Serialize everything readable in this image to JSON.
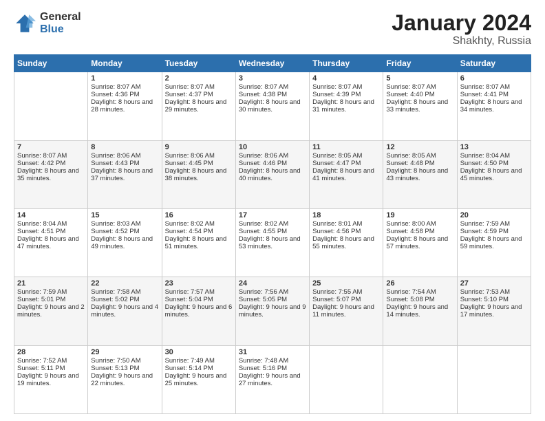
{
  "logo": {
    "general": "General",
    "blue": "Blue"
  },
  "title": {
    "month_year": "January 2024",
    "location": "Shakhty, Russia"
  },
  "header_days": [
    "Sunday",
    "Monday",
    "Tuesday",
    "Wednesday",
    "Thursday",
    "Friday",
    "Saturday"
  ],
  "weeks": [
    [
      {
        "day": "",
        "sunrise": "",
        "sunset": "",
        "daylight": ""
      },
      {
        "day": "1",
        "sunrise": "Sunrise: 8:07 AM",
        "sunset": "Sunset: 4:36 PM",
        "daylight": "Daylight: 8 hours and 28 minutes."
      },
      {
        "day": "2",
        "sunrise": "Sunrise: 8:07 AM",
        "sunset": "Sunset: 4:37 PM",
        "daylight": "Daylight: 8 hours and 29 minutes."
      },
      {
        "day": "3",
        "sunrise": "Sunrise: 8:07 AM",
        "sunset": "Sunset: 4:38 PM",
        "daylight": "Daylight: 8 hours and 30 minutes."
      },
      {
        "day": "4",
        "sunrise": "Sunrise: 8:07 AM",
        "sunset": "Sunset: 4:39 PM",
        "daylight": "Daylight: 8 hours and 31 minutes."
      },
      {
        "day": "5",
        "sunrise": "Sunrise: 8:07 AM",
        "sunset": "Sunset: 4:40 PM",
        "daylight": "Daylight: 8 hours and 33 minutes."
      },
      {
        "day": "6",
        "sunrise": "Sunrise: 8:07 AM",
        "sunset": "Sunset: 4:41 PM",
        "daylight": "Daylight: 8 hours and 34 minutes."
      }
    ],
    [
      {
        "day": "7",
        "sunrise": "Sunrise: 8:07 AM",
        "sunset": "Sunset: 4:42 PM",
        "daylight": "Daylight: 8 hours and 35 minutes."
      },
      {
        "day": "8",
        "sunrise": "Sunrise: 8:06 AM",
        "sunset": "Sunset: 4:43 PM",
        "daylight": "Daylight: 8 hours and 37 minutes."
      },
      {
        "day": "9",
        "sunrise": "Sunrise: 8:06 AM",
        "sunset": "Sunset: 4:45 PM",
        "daylight": "Daylight: 8 hours and 38 minutes."
      },
      {
        "day": "10",
        "sunrise": "Sunrise: 8:06 AM",
        "sunset": "Sunset: 4:46 PM",
        "daylight": "Daylight: 8 hours and 40 minutes."
      },
      {
        "day": "11",
        "sunrise": "Sunrise: 8:05 AM",
        "sunset": "Sunset: 4:47 PM",
        "daylight": "Daylight: 8 hours and 41 minutes."
      },
      {
        "day": "12",
        "sunrise": "Sunrise: 8:05 AM",
        "sunset": "Sunset: 4:48 PM",
        "daylight": "Daylight: 8 hours and 43 minutes."
      },
      {
        "day": "13",
        "sunrise": "Sunrise: 8:04 AM",
        "sunset": "Sunset: 4:50 PM",
        "daylight": "Daylight: 8 hours and 45 minutes."
      }
    ],
    [
      {
        "day": "14",
        "sunrise": "Sunrise: 8:04 AM",
        "sunset": "Sunset: 4:51 PM",
        "daylight": "Daylight: 8 hours and 47 minutes."
      },
      {
        "day": "15",
        "sunrise": "Sunrise: 8:03 AM",
        "sunset": "Sunset: 4:52 PM",
        "daylight": "Daylight: 8 hours and 49 minutes."
      },
      {
        "day": "16",
        "sunrise": "Sunrise: 8:02 AM",
        "sunset": "Sunset: 4:54 PM",
        "daylight": "Daylight: 8 hours and 51 minutes."
      },
      {
        "day": "17",
        "sunrise": "Sunrise: 8:02 AM",
        "sunset": "Sunset: 4:55 PM",
        "daylight": "Daylight: 8 hours and 53 minutes."
      },
      {
        "day": "18",
        "sunrise": "Sunrise: 8:01 AM",
        "sunset": "Sunset: 4:56 PM",
        "daylight": "Daylight: 8 hours and 55 minutes."
      },
      {
        "day": "19",
        "sunrise": "Sunrise: 8:00 AM",
        "sunset": "Sunset: 4:58 PM",
        "daylight": "Daylight: 8 hours and 57 minutes."
      },
      {
        "day": "20",
        "sunrise": "Sunrise: 7:59 AM",
        "sunset": "Sunset: 4:59 PM",
        "daylight": "Daylight: 8 hours and 59 minutes."
      }
    ],
    [
      {
        "day": "21",
        "sunrise": "Sunrise: 7:59 AM",
        "sunset": "Sunset: 5:01 PM",
        "daylight": "Daylight: 9 hours and 2 minutes."
      },
      {
        "day": "22",
        "sunrise": "Sunrise: 7:58 AM",
        "sunset": "Sunset: 5:02 PM",
        "daylight": "Daylight: 9 hours and 4 minutes."
      },
      {
        "day": "23",
        "sunrise": "Sunrise: 7:57 AM",
        "sunset": "Sunset: 5:04 PM",
        "daylight": "Daylight: 9 hours and 6 minutes."
      },
      {
        "day": "24",
        "sunrise": "Sunrise: 7:56 AM",
        "sunset": "Sunset: 5:05 PM",
        "daylight": "Daylight: 9 hours and 9 minutes."
      },
      {
        "day": "25",
        "sunrise": "Sunrise: 7:55 AM",
        "sunset": "Sunset: 5:07 PM",
        "daylight": "Daylight: 9 hours and 11 minutes."
      },
      {
        "day": "26",
        "sunrise": "Sunrise: 7:54 AM",
        "sunset": "Sunset: 5:08 PM",
        "daylight": "Daylight: 9 hours and 14 minutes."
      },
      {
        "day": "27",
        "sunrise": "Sunrise: 7:53 AM",
        "sunset": "Sunset: 5:10 PM",
        "daylight": "Daylight: 9 hours and 17 minutes."
      }
    ],
    [
      {
        "day": "28",
        "sunrise": "Sunrise: 7:52 AM",
        "sunset": "Sunset: 5:11 PM",
        "daylight": "Daylight: 9 hours and 19 minutes."
      },
      {
        "day": "29",
        "sunrise": "Sunrise: 7:50 AM",
        "sunset": "Sunset: 5:13 PM",
        "daylight": "Daylight: 9 hours and 22 minutes."
      },
      {
        "day": "30",
        "sunrise": "Sunrise: 7:49 AM",
        "sunset": "Sunset: 5:14 PM",
        "daylight": "Daylight: 9 hours and 25 minutes."
      },
      {
        "day": "31",
        "sunrise": "Sunrise: 7:48 AM",
        "sunset": "Sunset: 5:16 PM",
        "daylight": "Daylight: 9 hours and 27 minutes."
      },
      {
        "day": "",
        "sunrise": "",
        "sunset": "",
        "daylight": ""
      },
      {
        "day": "",
        "sunrise": "",
        "sunset": "",
        "daylight": ""
      },
      {
        "day": "",
        "sunrise": "",
        "sunset": "",
        "daylight": ""
      }
    ]
  ]
}
